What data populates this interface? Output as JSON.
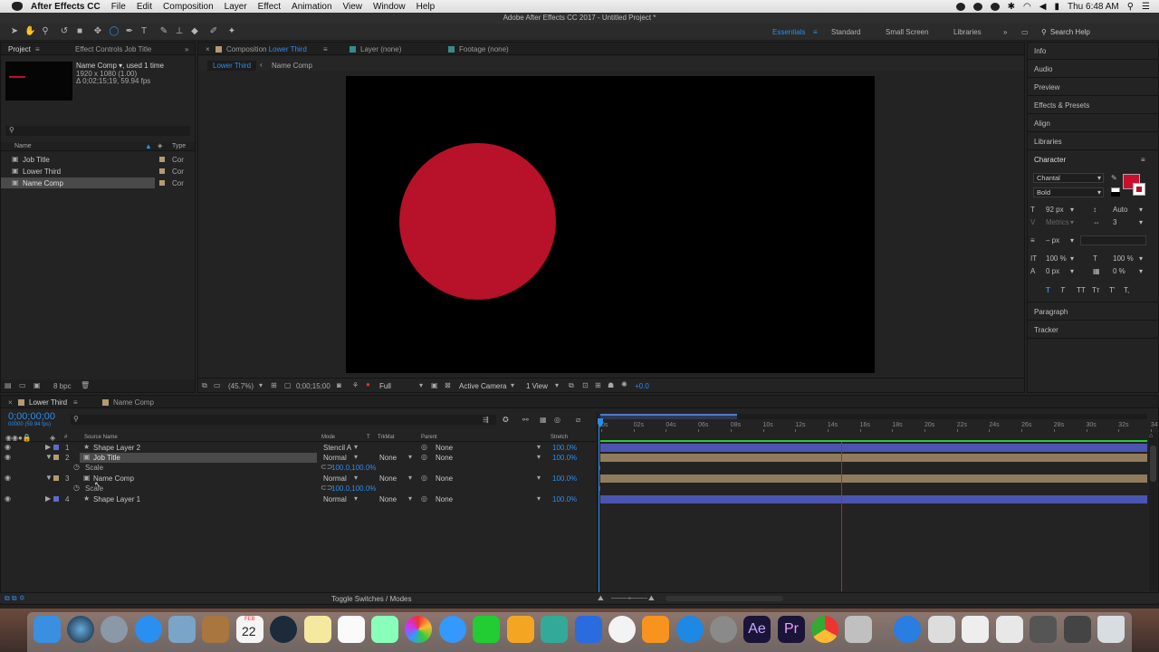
{
  "menubar": {
    "app": "After Effects CC",
    "items": [
      "File",
      "Edit",
      "Composition",
      "Layer",
      "Effect",
      "Animation",
      "View",
      "Window",
      "Help"
    ],
    "clock": "Thu 6:48 AM"
  },
  "window_title": "Adobe After Effects CC 2017 - Untitled Project *",
  "workspaces": {
    "essentials": "Essentials",
    "standard": "Standard",
    "small_screen": "Small Screen",
    "libraries": "Libraries"
  },
  "search_help": "Search Help",
  "project": {
    "tab": "Project",
    "effect_controls_tab": "Effect Controls Job Title",
    "item_name": "Name Comp",
    "used": ", used 1 time",
    "dims": "1920 x 1080 (1.00)",
    "duration": "Δ 0;02;15;19, 59.94 fps",
    "col_name": "Name",
    "col_type": "Type",
    "items": [
      {
        "name": "Job Title",
        "type": "Cor"
      },
      {
        "name": "Lower Third",
        "type": "Cor"
      },
      {
        "name": "Name Comp",
        "type": "Cor"
      }
    ],
    "bpc": "8 bpc"
  },
  "viewer": {
    "tab_comp_prefix": "Composition",
    "tab_comp_name": "Lower Third",
    "tab_layer": "Layer (none)",
    "tab_footage": "Footage (none)",
    "breadcrumb_1": "Lower Third",
    "breadcrumb_2": "Name Comp",
    "zoom": "(45.7%)",
    "timecode": "0;00;15;00",
    "resolution": "Full",
    "camera": "Active Camera",
    "views": "1 View",
    "exposure": "+0.0"
  },
  "right_panel": {
    "info": "Info",
    "audio": "Audio",
    "preview": "Preview",
    "effects": "Effects & Presets",
    "align": "Align",
    "libraries": "Libraries",
    "character": "Character",
    "font": "Chantal",
    "style": "Bold",
    "size": "92 px",
    "leading": "Auto",
    "kerning": "Metrics",
    "tracking": "3",
    "stroke": "– px",
    "vscale": "100 %",
    "hscale": "100 %",
    "baseline": "0 px",
    "tsume": "0 %",
    "styles": [
      "T",
      "T",
      "TT",
      "Tт",
      "T'",
      "T,"
    ],
    "paragraph": "Paragraph",
    "tracker": "Tracker",
    "fill_color": "#c8102e"
  },
  "timeline": {
    "tab_1": "Lower Third",
    "tab_2": "Name Comp",
    "timecode": "0;00;00;00",
    "frames": "00000 (59.94 fps)",
    "col_source": "Source Name",
    "col_mode": "Mode",
    "col_t": "T",
    "col_trkmat": "TrkMat",
    "col_parent": "Parent",
    "col_stretch": "Stretch",
    "layers": [
      {
        "num": "1",
        "name": "Shape Layer 2",
        "mode": "Stencil A",
        "trkmat": "",
        "parent": "None",
        "stretch": "100.0%",
        "color": "#5b6bd4"
      },
      {
        "num": "2",
        "name": "Job Title",
        "mode": "Normal",
        "trkmat": "None",
        "parent": "None",
        "stretch": "100.0%",
        "color": "#b39a72"
      },
      {
        "num": "3",
        "name": "Name Comp",
        "mode": "Normal",
        "trkmat": "None",
        "parent": "None",
        "stretch": "100.0%",
        "color": "#b39a72"
      },
      {
        "num": "4",
        "name": "Shape Layer 1",
        "mode": "Normal",
        "trkmat": "None",
        "parent": "None",
        "stretch": "100.0%",
        "color": "#5b6bd4"
      }
    ],
    "scale_label": "Scale",
    "scale_value": "100.0,100.0%",
    "ruler": [
      "0s",
      "02s",
      "04s",
      "06s",
      "08s",
      "10s",
      "12s",
      "14s",
      "16s",
      "18s",
      "20s",
      "22s",
      "24s",
      "26s",
      "28s",
      "30s",
      "32s",
      "34"
    ],
    "toggle": "Toggle Switches / Modes"
  },
  "dock": {
    "calendar_month": "FEB",
    "calendar_day": "22",
    "ae": "Ae",
    "pr": "Pr"
  }
}
